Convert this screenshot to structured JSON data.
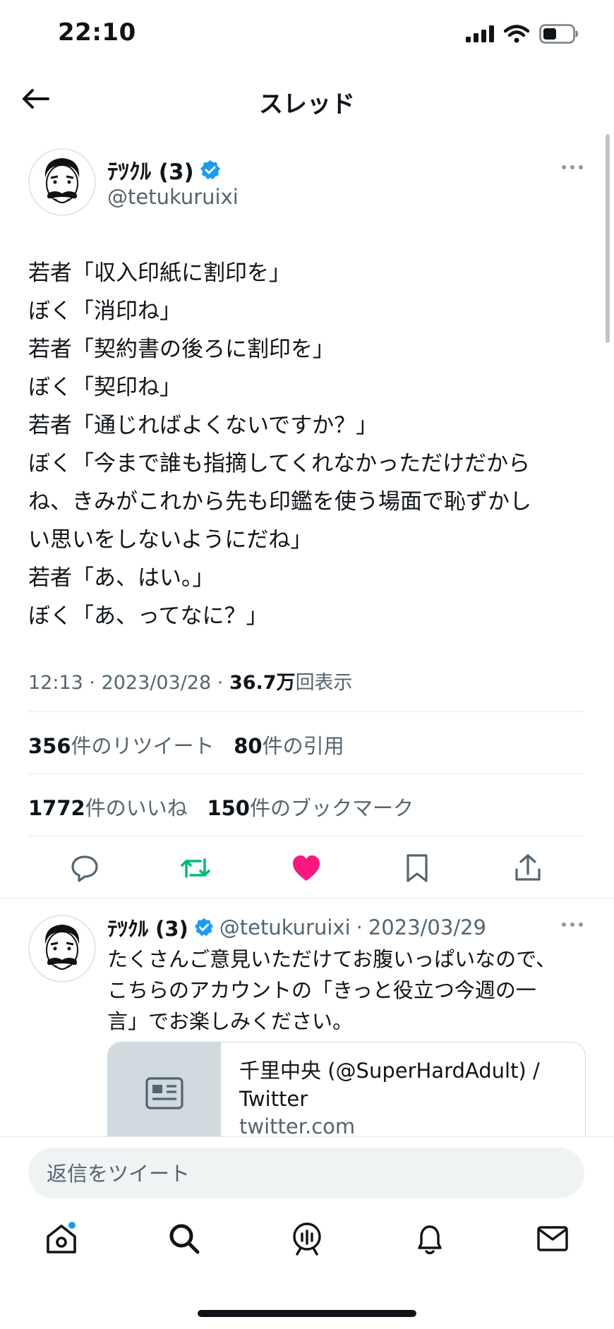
{
  "status_bar": {
    "time": "22:10"
  },
  "header": {
    "title": "スレッド"
  },
  "tweet": {
    "author_name": "ﾃﾂｸﾙ (3)",
    "author_handle": "@tetukuruixi",
    "lines": [
      "若者「収入印紙に割印を」",
      "ぼく「消印ね」",
      "若者「契約書の後ろに割印を」",
      "ぼく「契印ね」",
      "若者「通じればよくないですか？」",
      "ぼく「今まで誰も指摘してくれなかっただけだから",
      "ね、きみがこれから先も印鑑を使う場面で恥ずかし",
      "い思いをしないようにだね」",
      "若者「あ、はい。」",
      "ぼく「あ、ってなに？」"
    ],
    "time": "12:13",
    "date": "2023/03/28",
    "views_count": "36.7万",
    "views_label": "回表示",
    "retweets_count": "356",
    "retweets_label": "件のリツイート",
    "quotes_count": "80",
    "quotes_label": "件の引用",
    "likes_count": "1772",
    "likes_label": "件のいいね",
    "bookmarks_count": "150",
    "bookmarks_label": "件のブックマーク"
  },
  "reply": {
    "author_name": "ﾃﾂｸﾙ (3)",
    "author_handle": "@tetukuruixi",
    "date": "2023/03/29",
    "text_lines": [
      "たくさんご意見いただけてお腹いっぱいなので、",
      "こちらのアカウントの「きっと役立つ今週の一",
      "言」でお楽しみください。"
    ],
    "card": {
      "title": "千里中央 (@SuperHardAdult) / Twitter",
      "domain": "twitter.com"
    }
  },
  "composer": {
    "placeholder": "返信をツイート"
  },
  "colors": {
    "accent": "#1d9bf0",
    "retweet": "#00ba7c",
    "like": "#f91880",
    "secondary_text": "#536471"
  },
  "icons": [
    "back-arrow-icon",
    "verified-badge-icon",
    "more-icon",
    "reply-icon",
    "retweet-icon",
    "like-icon",
    "bookmark-icon",
    "share-icon",
    "article-icon",
    "home-icon",
    "search-icon",
    "spaces-icon",
    "notifications-icon",
    "messages-icon",
    "signal-icon",
    "wifi-icon",
    "battery-icon"
  ]
}
